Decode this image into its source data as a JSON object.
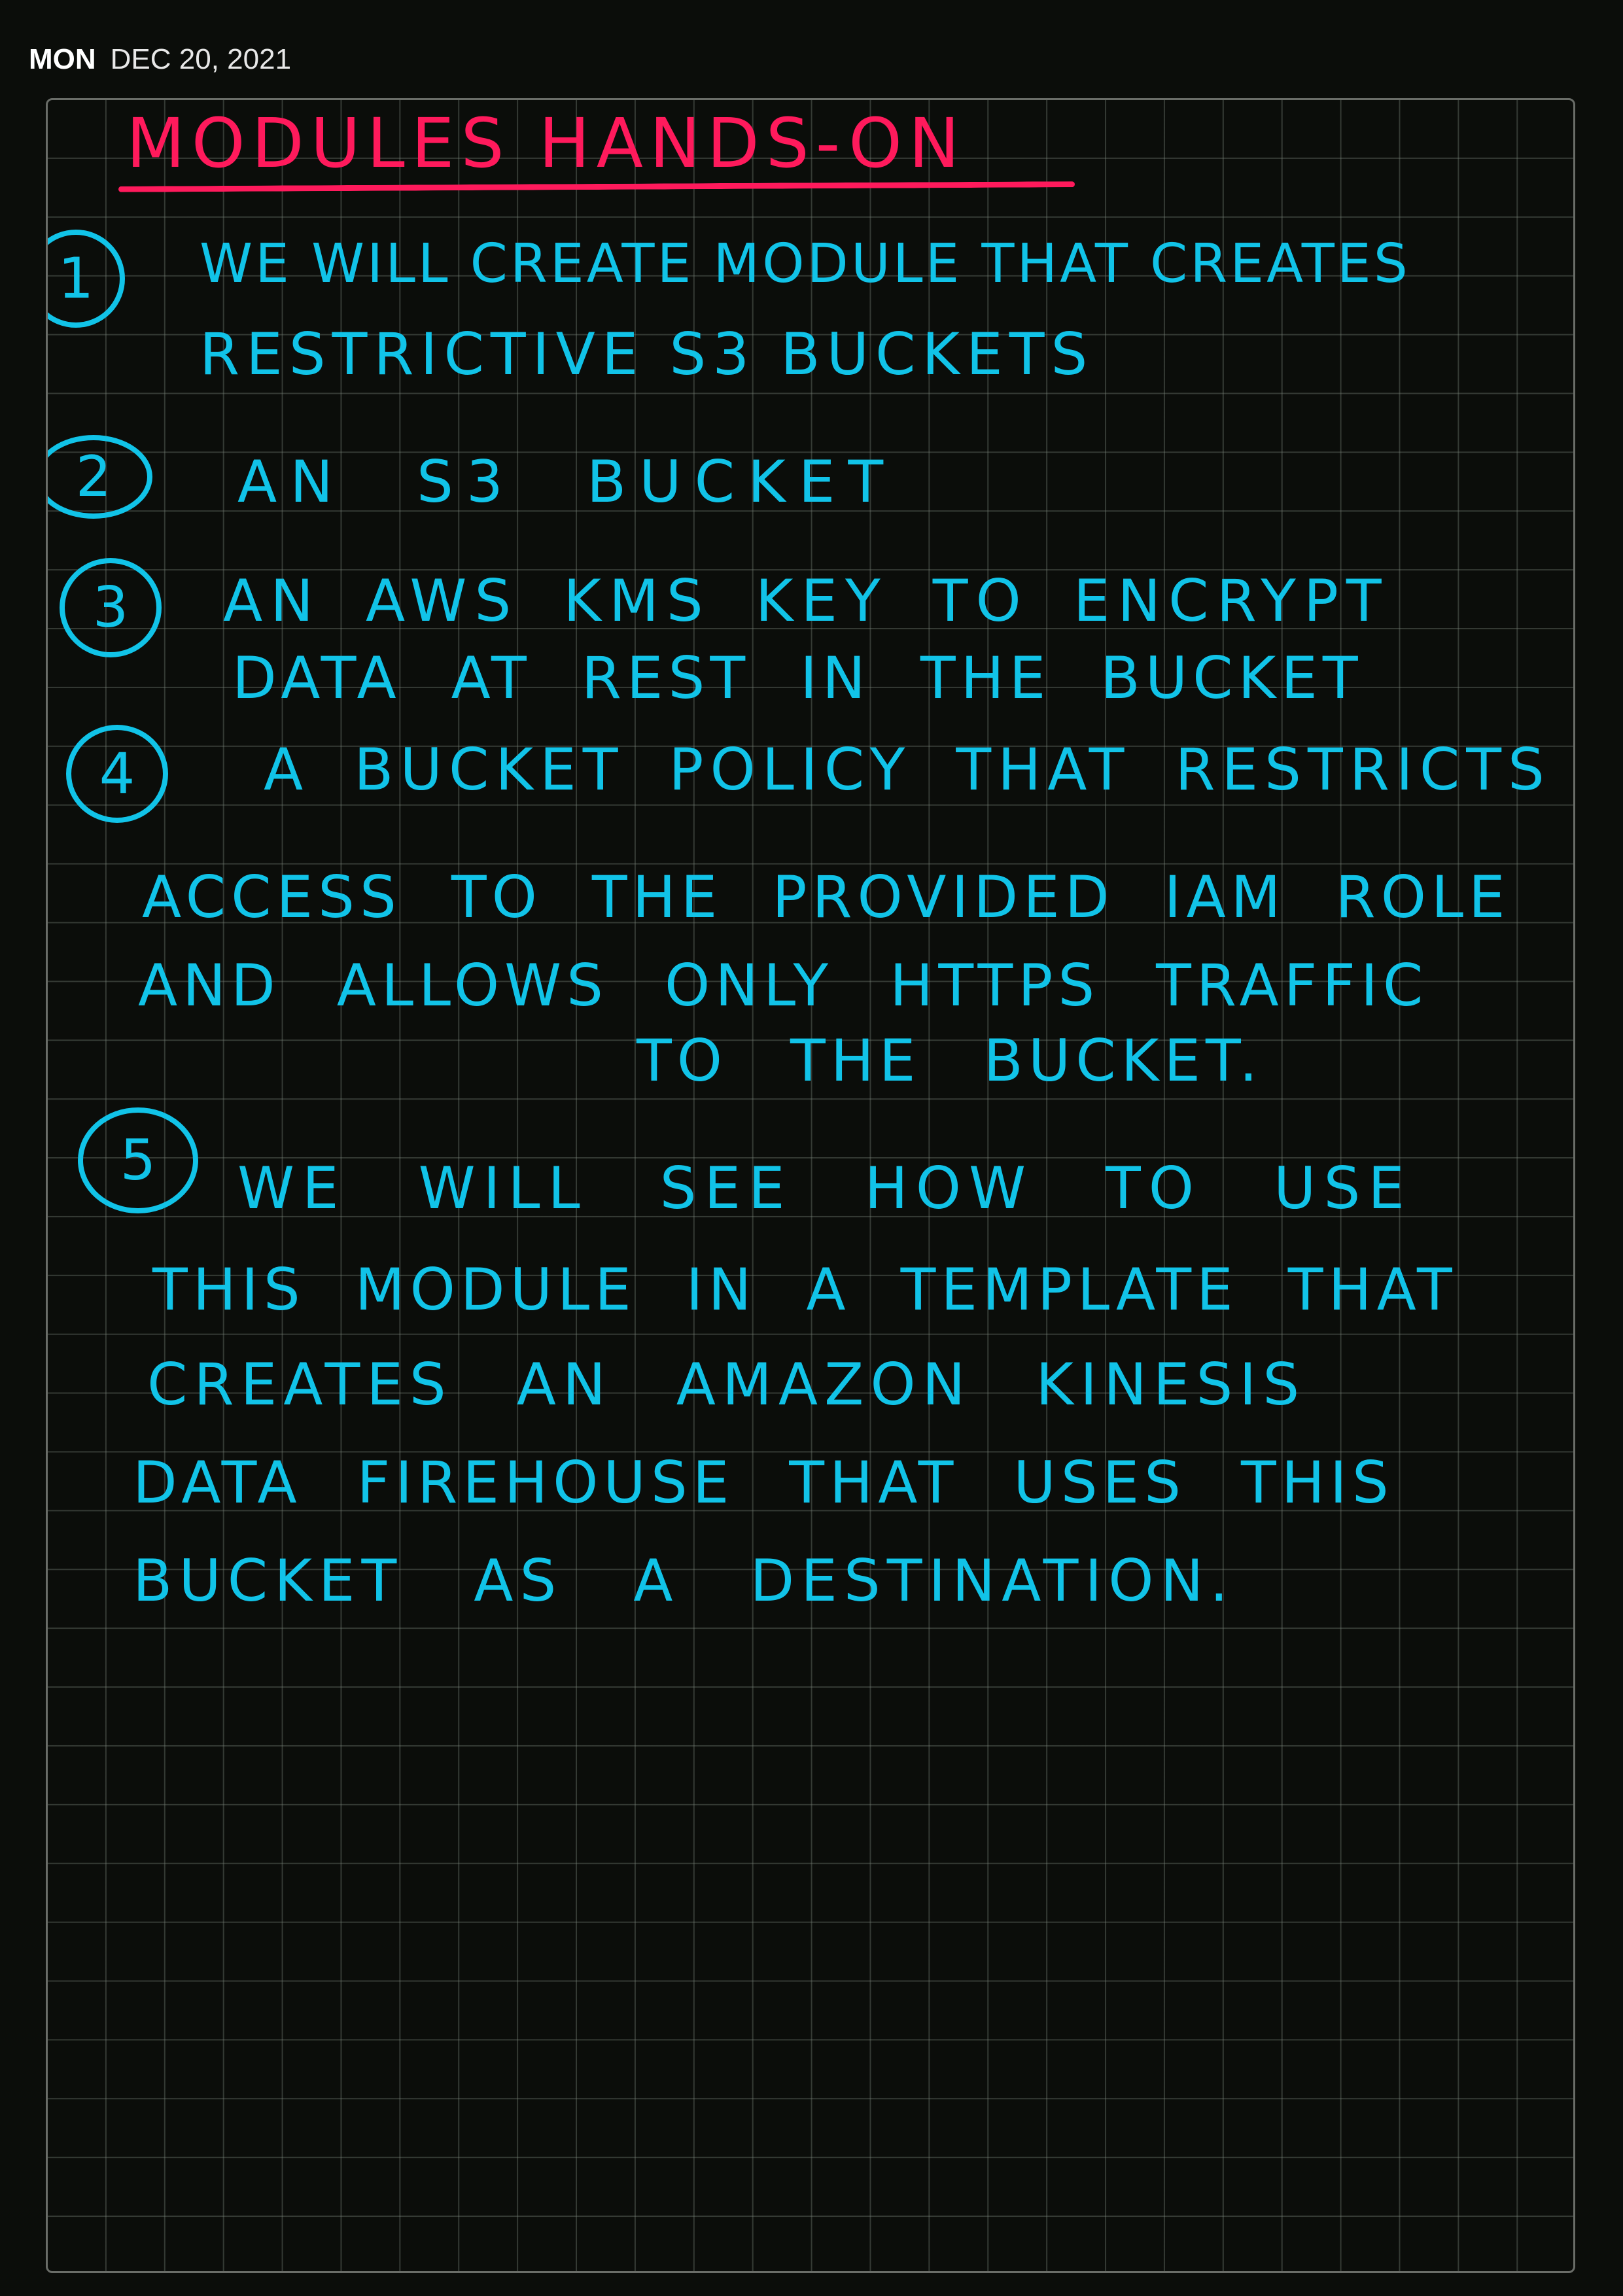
{
  "header": {
    "day": "MON",
    "date": "DEC 20, 2021"
  },
  "note": {
    "title": "MODULES HANDS-ON",
    "colors": {
      "background": "#0b0d0a",
      "grid": "#3d423c",
      "title_ink": "#ff1a5c",
      "body_ink": "#11c3e8"
    },
    "items": [
      {
        "number": "1",
        "lines": [
          "WE WILL CREATE MODULE THAT CREATES",
          "RESTRICTIVE S3 BUCKETS"
        ]
      },
      {
        "number": "2",
        "lines": [
          "AN S3 BUCKET"
        ]
      },
      {
        "number": "3",
        "lines": [
          "AN AWS KMS KEY TO ENCRYPT",
          "DATA AT REST IN THE BUCKET"
        ]
      },
      {
        "number": "4",
        "lines": [
          "A BUCKET POLICY THAT RESTRICTS",
          "ACCESS TO THE PROVIDED IAM ROLE",
          "AND ALLOWS ONLY HTTPS TRAFFIC",
          "TO THE BUCKET."
        ]
      },
      {
        "number": "5",
        "lines": [
          "WE WILL SEE HOW TO USE",
          "THIS MODULE IN A TEMPLATE THAT",
          "CREATES AN AMAZON KINESIS",
          "DATA FIREHOUSE THAT USES THIS",
          "BUCKET AS A DESTINATION."
        ]
      }
    ]
  }
}
